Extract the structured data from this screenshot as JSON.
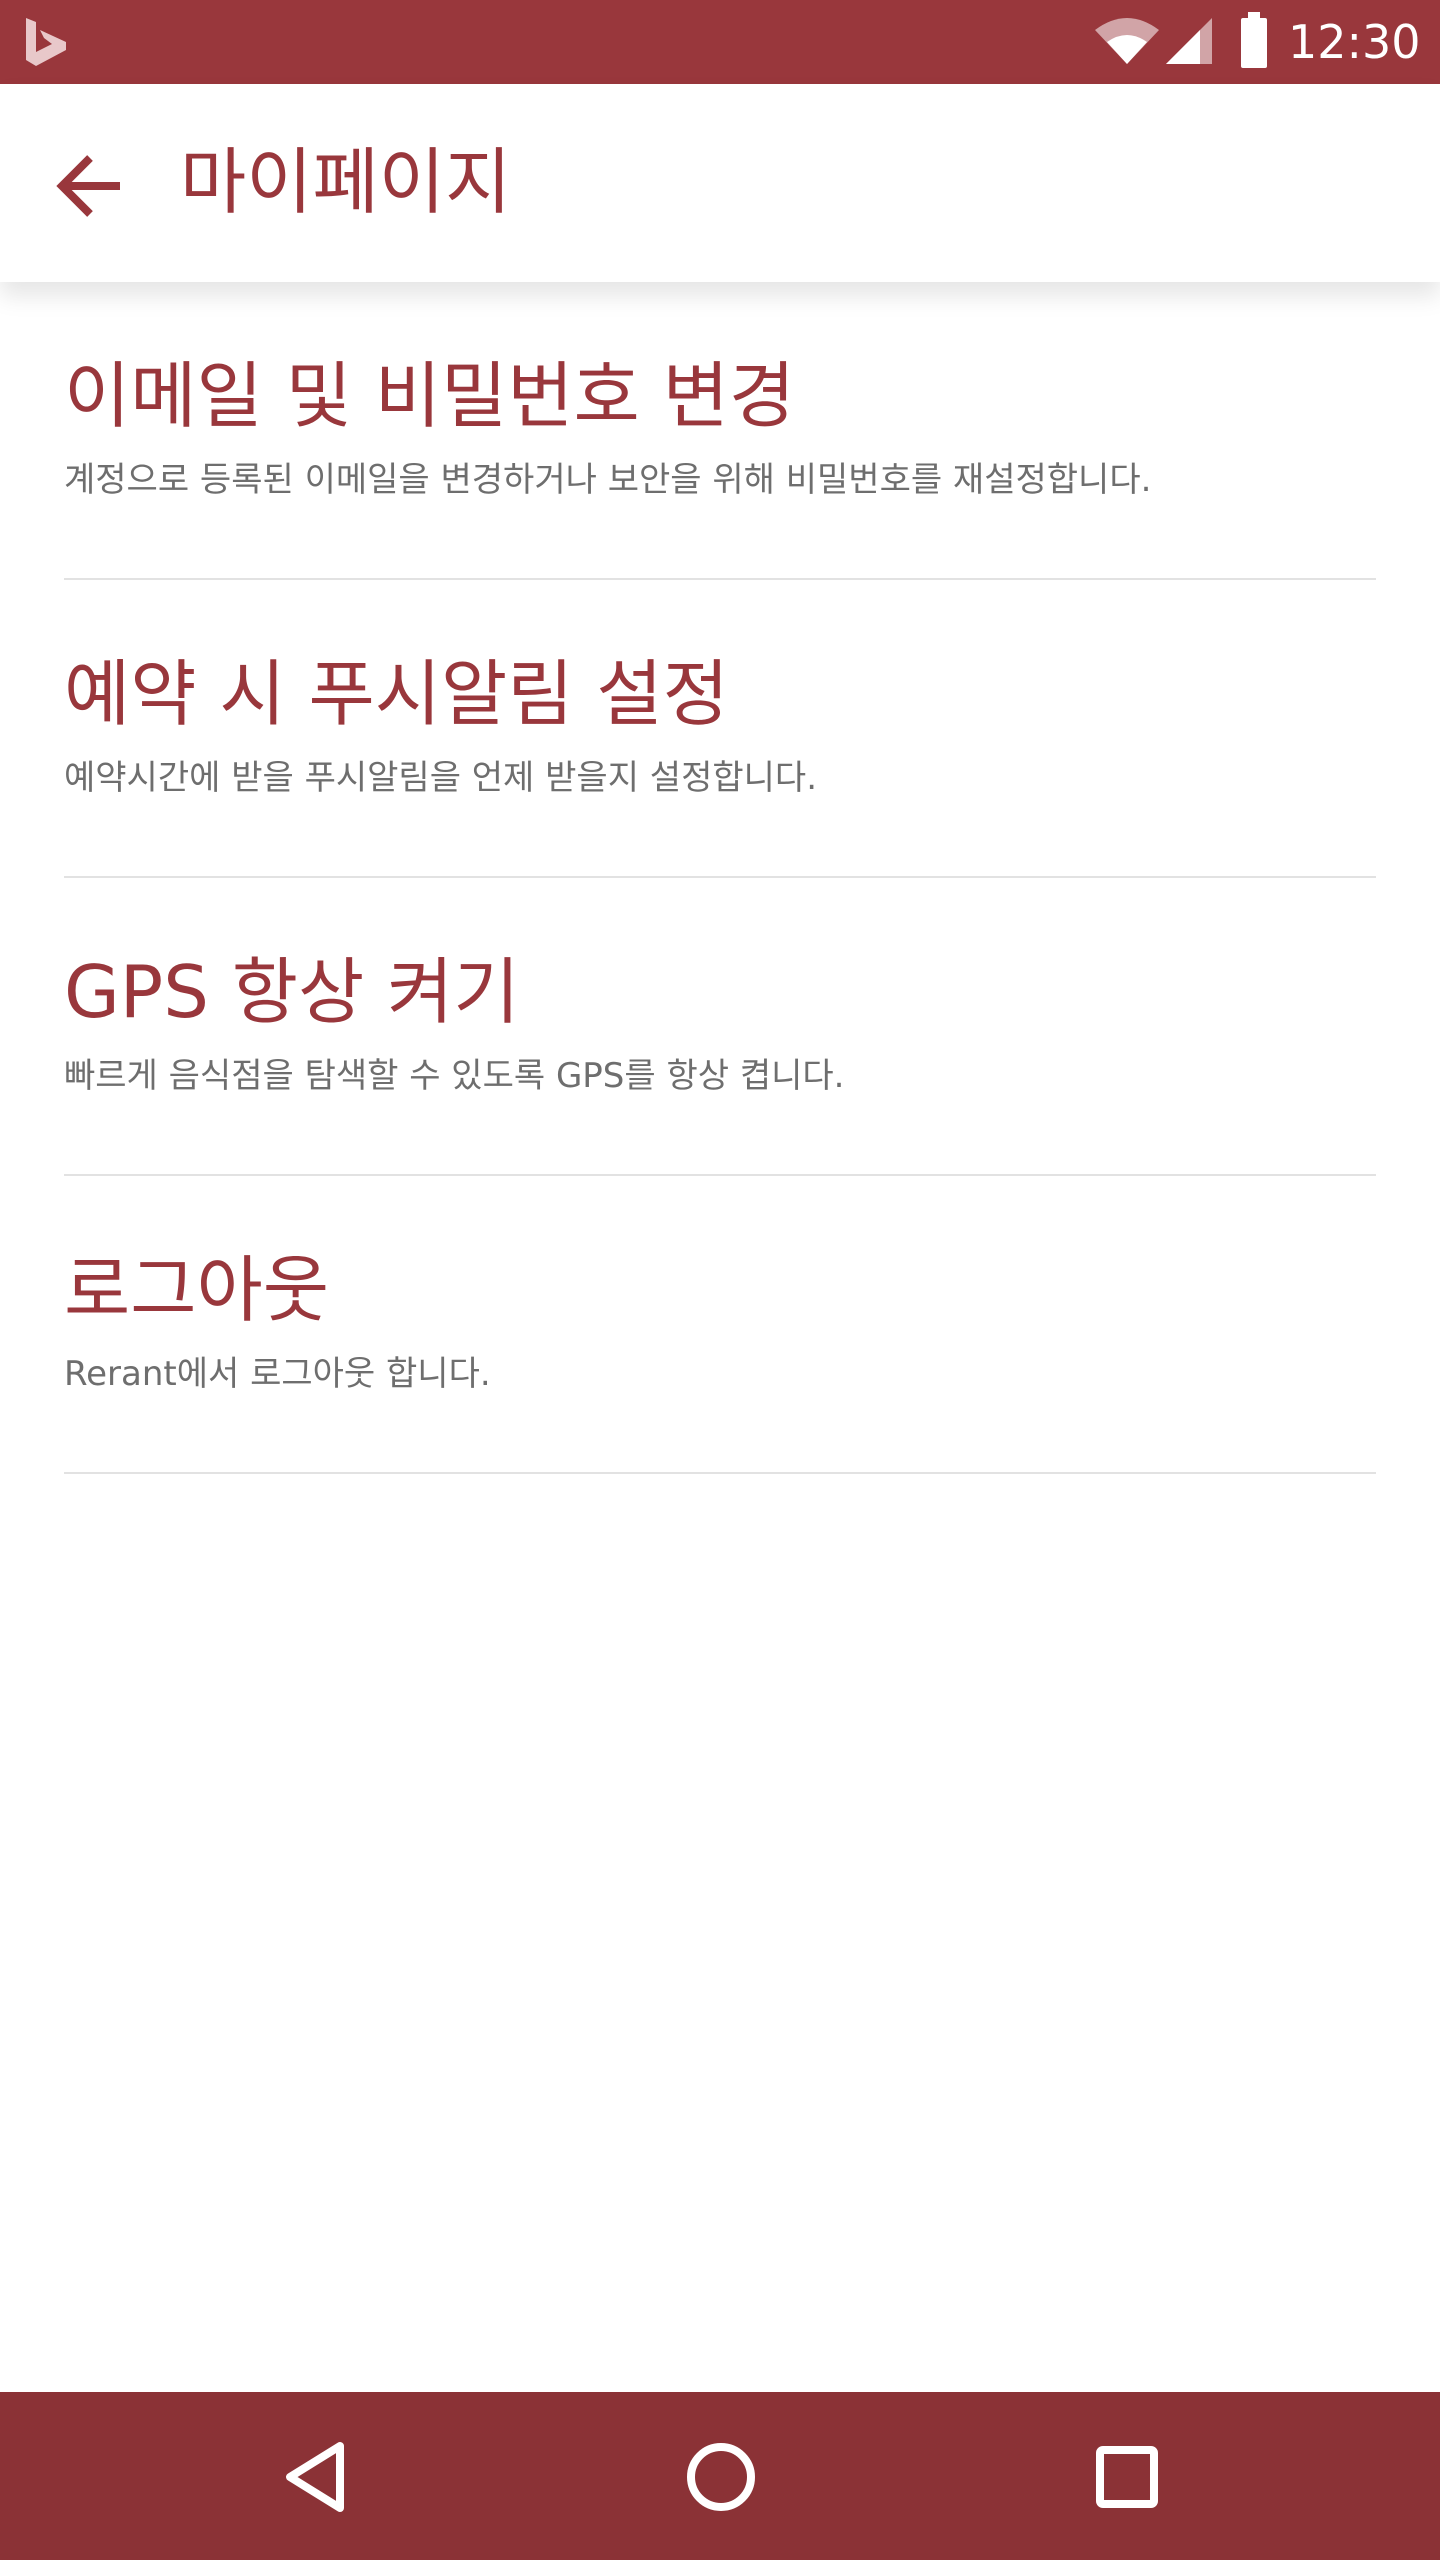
{
  "status_bar": {
    "time": "12:30",
    "icons": [
      "bing-app-icon",
      "wifi-icon",
      "signal-icon",
      "battery-icon"
    ]
  },
  "app_bar": {
    "back_icon": "arrow-left-icon",
    "title": "마이페이지"
  },
  "settings": [
    {
      "title": "이메일 및 비밀번호 변경",
      "description": "계정으로 등록된 이메일을 변경하거나 보안을 위해 비밀번호를 재설정합니다."
    },
    {
      "title": "예약 시 푸시알림 설정",
      "description": "예약시간에 받을 푸시알림을 언제 받을지 설정합니다."
    },
    {
      "title": "GPS 항상 켜기",
      "description": "빠르게 음식점을 탐색할 수 있도록 GPS를 항상 켭니다."
    },
    {
      "title": "로그아웃",
      "description": "Rerant에서 로그아웃 합니다."
    }
  ],
  "nav_bar": {
    "icons": [
      "back-triangle-icon",
      "home-circle-icon",
      "recents-square-icon"
    ]
  },
  "colors": {
    "accent": "#99373c",
    "nav_bar": "#8b3236",
    "description_text": "#6e6e6e",
    "divider": "#e2e2e2"
  }
}
